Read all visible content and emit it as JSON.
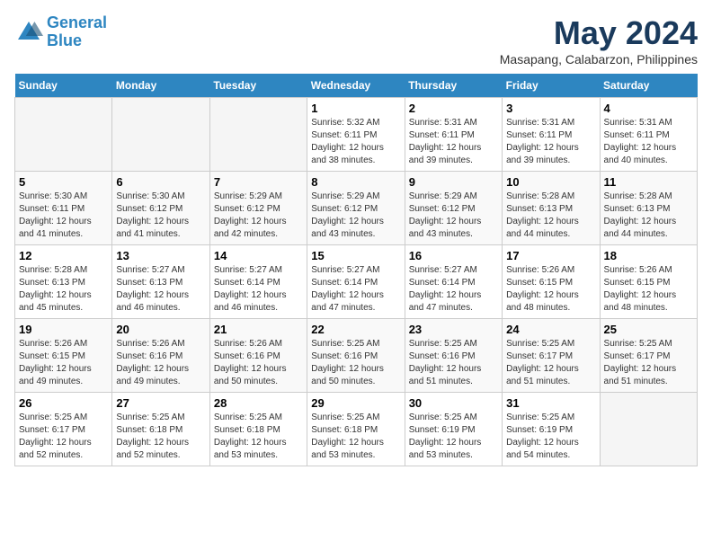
{
  "header": {
    "logo_line1": "General",
    "logo_line2": "Blue",
    "month": "May 2024",
    "location": "Masapang, Calabarzon, Philippines"
  },
  "weekdays": [
    "Sunday",
    "Monday",
    "Tuesday",
    "Wednesday",
    "Thursday",
    "Friday",
    "Saturday"
  ],
  "weeks": [
    [
      {
        "day": "",
        "empty": true
      },
      {
        "day": "",
        "empty": true
      },
      {
        "day": "",
        "empty": true
      },
      {
        "day": "1",
        "sunrise": "5:32 AM",
        "sunset": "6:11 PM",
        "daylight": "12 hours and 38 minutes."
      },
      {
        "day": "2",
        "sunrise": "5:31 AM",
        "sunset": "6:11 PM",
        "daylight": "12 hours and 39 minutes."
      },
      {
        "day": "3",
        "sunrise": "5:31 AM",
        "sunset": "6:11 PM",
        "daylight": "12 hours and 39 minutes."
      },
      {
        "day": "4",
        "sunrise": "5:31 AM",
        "sunset": "6:11 PM",
        "daylight": "12 hours and 40 minutes."
      }
    ],
    [
      {
        "day": "5",
        "sunrise": "5:30 AM",
        "sunset": "6:11 PM",
        "daylight": "12 hours and 41 minutes."
      },
      {
        "day": "6",
        "sunrise": "5:30 AM",
        "sunset": "6:12 PM",
        "daylight": "12 hours and 41 minutes."
      },
      {
        "day": "7",
        "sunrise": "5:29 AM",
        "sunset": "6:12 PM",
        "daylight": "12 hours and 42 minutes."
      },
      {
        "day": "8",
        "sunrise": "5:29 AM",
        "sunset": "6:12 PM",
        "daylight": "12 hours and 43 minutes."
      },
      {
        "day": "9",
        "sunrise": "5:29 AM",
        "sunset": "6:12 PM",
        "daylight": "12 hours and 43 minutes."
      },
      {
        "day": "10",
        "sunrise": "5:28 AM",
        "sunset": "6:13 PM",
        "daylight": "12 hours and 44 minutes."
      },
      {
        "day": "11",
        "sunrise": "5:28 AM",
        "sunset": "6:13 PM",
        "daylight": "12 hours and 44 minutes."
      }
    ],
    [
      {
        "day": "12",
        "sunrise": "5:28 AM",
        "sunset": "6:13 PM",
        "daylight": "12 hours and 45 minutes."
      },
      {
        "day": "13",
        "sunrise": "5:27 AM",
        "sunset": "6:13 PM",
        "daylight": "12 hours and 46 minutes."
      },
      {
        "day": "14",
        "sunrise": "5:27 AM",
        "sunset": "6:14 PM",
        "daylight": "12 hours and 46 minutes."
      },
      {
        "day": "15",
        "sunrise": "5:27 AM",
        "sunset": "6:14 PM",
        "daylight": "12 hours and 47 minutes."
      },
      {
        "day": "16",
        "sunrise": "5:27 AM",
        "sunset": "6:14 PM",
        "daylight": "12 hours and 47 minutes."
      },
      {
        "day": "17",
        "sunrise": "5:26 AM",
        "sunset": "6:15 PM",
        "daylight": "12 hours and 48 minutes."
      },
      {
        "day": "18",
        "sunrise": "5:26 AM",
        "sunset": "6:15 PM",
        "daylight": "12 hours and 48 minutes."
      }
    ],
    [
      {
        "day": "19",
        "sunrise": "5:26 AM",
        "sunset": "6:15 PM",
        "daylight": "12 hours and 49 minutes."
      },
      {
        "day": "20",
        "sunrise": "5:26 AM",
        "sunset": "6:16 PM",
        "daylight": "12 hours and 49 minutes."
      },
      {
        "day": "21",
        "sunrise": "5:26 AM",
        "sunset": "6:16 PM",
        "daylight": "12 hours and 50 minutes."
      },
      {
        "day": "22",
        "sunrise": "5:25 AM",
        "sunset": "6:16 PM",
        "daylight": "12 hours and 50 minutes."
      },
      {
        "day": "23",
        "sunrise": "5:25 AM",
        "sunset": "6:16 PM",
        "daylight": "12 hours and 51 minutes."
      },
      {
        "day": "24",
        "sunrise": "5:25 AM",
        "sunset": "6:17 PM",
        "daylight": "12 hours and 51 minutes."
      },
      {
        "day": "25",
        "sunrise": "5:25 AM",
        "sunset": "6:17 PM",
        "daylight": "12 hours and 51 minutes."
      }
    ],
    [
      {
        "day": "26",
        "sunrise": "5:25 AM",
        "sunset": "6:17 PM",
        "daylight": "12 hours and 52 minutes."
      },
      {
        "day": "27",
        "sunrise": "5:25 AM",
        "sunset": "6:18 PM",
        "daylight": "12 hours and 52 minutes."
      },
      {
        "day": "28",
        "sunrise": "5:25 AM",
        "sunset": "6:18 PM",
        "daylight": "12 hours and 53 minutes."
      },
      {
        "day": "29",
        "sunrise": "5:25 AM",
        "sunset": "6:18 PM",
        "daylight": "12 hours and 53 minutes."
      },
      {
        "day": "30",
        "sunrise": "5:25 AM",
        "sunset": "6:19 PM",
        "daylight": "12 hours and 53 minutes."
      },
      {
        "day": "31",
        "sunrise": "5:25 AM",
        "sunset": "6:19 PM",
        "daylight": "12 hours and 54 minutes."
      },
      {
        "day": "",
        "empty": true
      }
    ]
  ]
}
